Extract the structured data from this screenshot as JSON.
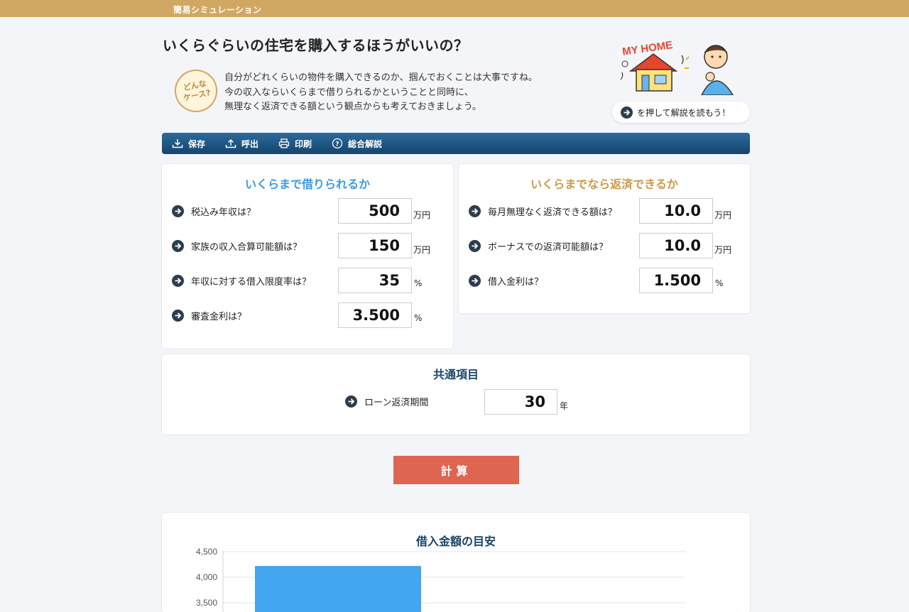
{
  "header": {
    "title": "簡易シミュレーション"
  },
  "page": {
    "title": "いくらぐらいの住宅を購入するほうがいいの？",
    "badge": "どんな\nケース?",
    "intro": [
      "自分がどれくらいの物件を購入できるのか、掴んでおくことは大事ですね。",
      "今の収入ならいくらまで借りられるかということと同時に、",
      "無理なく返済できる額という観点からも考えておきましょう。"
    ],
    "hero_sign": "MY HOME",
    "hint": "を押して解説を読もう！"
  },
  "toolbar": {
    "save": "保存",
    "load": "呼出",
    "print": "印刷",
    "help": "総合解説"
  },
  "borrow": {
    "title": "いくらまで借りられるか",
    "title_color": "#3d9ae0",
    "rows": [
      {
        "label": "税込み年収は？",
        "value": "500",
        "unit": "万円"
      },
      {
        "label": "家族の収入合算可能額は？",
        "value": "150",
        "unit": "万円"
      },
      {
        "label": "年収に対する借入限度率は？",
        "value": "35",
        "unit": "%"
      },
      {
        "label": "審査金利は？",
        "value": "3.500",
        "unit": "%"
      }
    ]
  },
  "repay": {
    "title": "いくらまでなら返済できるか",
    "title_color": "#c99a48",
    "rows": [
      {
        "label": "毎月無理なく返済できる額は？",
        "value": "10.0",
        "unit": "万円"
      },
      {
        "label": "ボーナスでの返済可能額は？",
        "value": "10.0",
        "unit": "万円"
      },
      {
        "label": "借入金利は？",
        "value": "1.500",
        "unit": "%"
      }
    ]
  },
  "common": {
    "title": "共通項目",
    "label": "ローン返済期間",
    "value": "30",
    "unit": "年"
  },
  "calc_button": "計算",
  "chart_data": {
    "type": "bar",
    "title": "借入金額の目安",
    "categories": [
      ""
    ],
    "values": [
      4220
    ],
    "yticks": [
      "4,500",
      "4,000",
      "3,500"
    ],
    "ylim": [
      3500,
      4500
    ],
    "grid": true,
    "bar_color": "#42a6f0"
  }
}
